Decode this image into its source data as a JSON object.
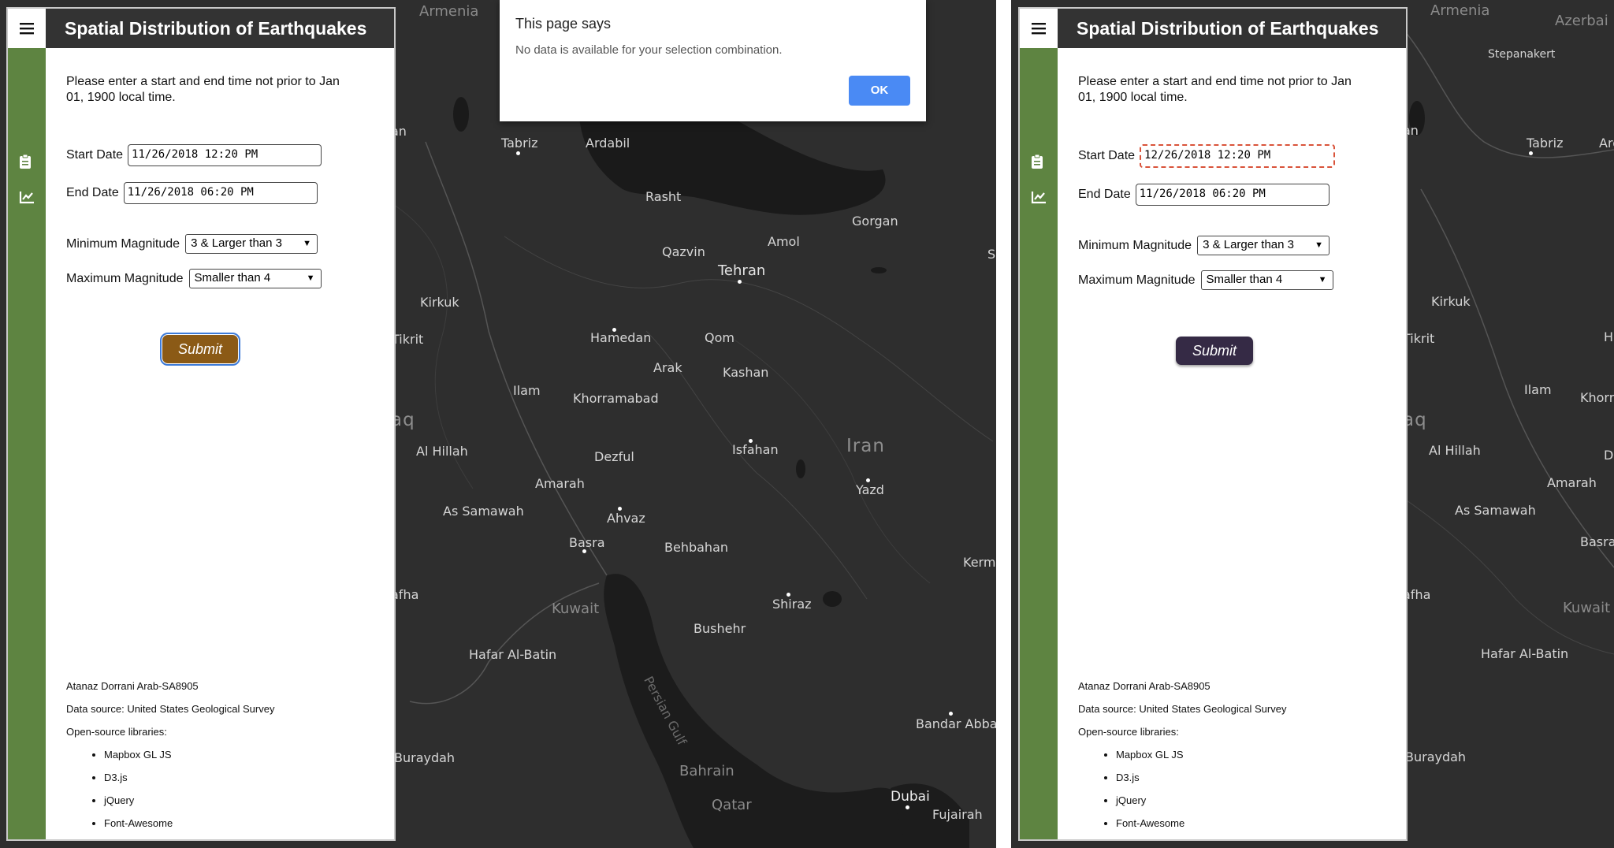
{
  "app": {
    "title": "Spatial Distribution of Earthquakes",
    "menu_icon": "hamburger-icon",
    "rail_icons": [
      "clipboard-icon",
      "line-chart-icon"
    ],
    "intro_text": "Please enter a start and end time not prior to Jan 01, 1900 local time.",
    "start_date_label": "Start Date",
    "end_date_label": "End Date",
    "min_mag_label": "Minimum Magnitude",
    "max_mag_label": "Maximum Magnitude",
    "min_mag_value": "3 & Larger than 3",
    "max_mag_value": "Smaller than 4",
    "submit_label": "Submit",
    "credit": "Atanaz Dorrani Arab-SA8905",
    "data_source": "Data source: United States Geological Survey",
    "libraries_label": "Open-source libraries:",
    "libraries": [
      "Mapbox GL JS",
      "D3.js",
      "jQuery",
      "Font-Awesome"
    ]
  },
  "left": {
    "start_date": "11/26/2018 12:20 PM",
    "end_date": "11/26/2018 06:20 PM",
    "submit_color": "#8b5a16"
  },
  "right": {
    "start_date": "12/26/2018 12:20 PM",
    "end_date": "11/26/2018 06:20 PM",
    "submit_color": "#352a45",
    "start_invalid_color": "#d9533a"
  },
  "dialog": {
    "title": "This page says",
    "message": "No data is available for your selection combination.",
    "ok_label": "OK"
  },
  "map_left": {
    "labels": [
      "Armenia",
      "Tabriz",
      "Ardabil",
      "Rasht",
      "Gorgan",
      "Amol",
      "Qazvin",
      "Tehran",
      "Kirkuk",
      "Hamedan",
      "Qom",
      "Tikrit",
      "Arak",
      "Kashan",
      "Ilam",
      "Khorramabad",
      "Iran",
      "Isfahan",
      "Yazd",
      "Al Hillah",
      "Dezful",
      "Amarah",
      "As Samawah",
      "Ahvaz",
      "Basra",
      "Behbahan",
      "Kuwait",
      "Shiraz",
      "Bushehr",
      "Hafar Al-Batin",
      "Persian Gulf",
      "Bandar Abbas",
      "Buraydah",
      "Bahrain",
      "Qatar",
      "Dubai",
      "Fujairah",
      "Kerma",
      "afha",
      "aq",
      "an",
      "S"
    ]
  },
  "map_right": {
    "labels": [
      "Armenia",
      "Azerbai",
      "Stepanakert",
      "Tabriz",
      "Ard",
      "an",
      "Kirkuk",
      "Tikrit",
      "H",
      "Ilam",
      "Khorr",
      "aq",
      "Al Hillah",
      "D",
      "Amarah",
      "As Samawah",
      "Basra",
      "afha",
      "Kuwait",
      "Hafar Al-Batin",
      "Buraydah"
    ]
  }
}
